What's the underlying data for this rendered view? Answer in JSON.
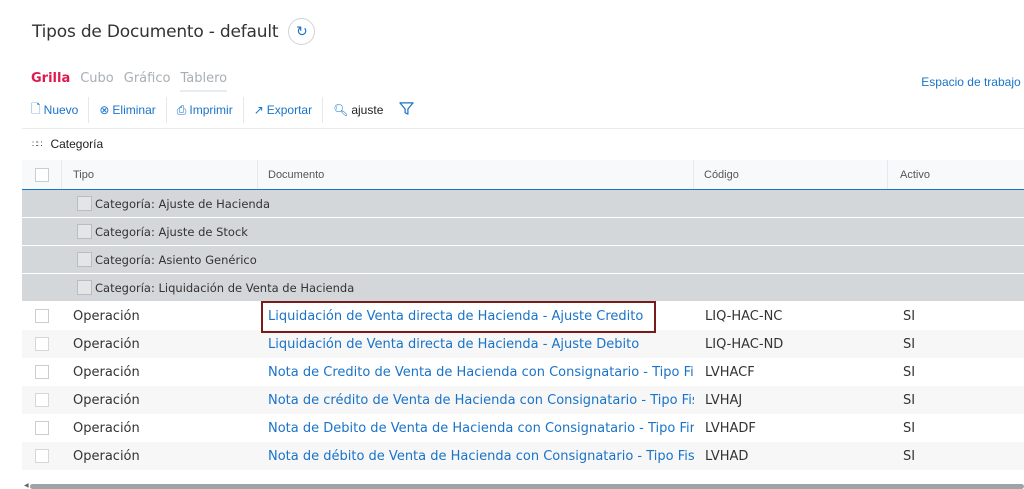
{
  "header": {
    "title": "Tipos de Documento - default"
  },
  "tabs": [
    "Grilla",
    "Cubo",
    "Gráfico",
    "Tablero"
  ],
  "workspace": {
    "label": "Espacio de trabajo"
  },
  "toolbar": {
    "new_label": "Nuevo",
    "delete_label": "Eliminar",
    "print_label": "Imprimir",
    "export_label": "Exportar",
    "search_value": "ajuste"
  },
  "groupby": {
    "label": "Categoría"
  },
  "grid": {
    "columns": [
      "Tipo",
      "Documento",
      "Código",
      "Activo"
    ],
    "groups": [
      "Categoría: Ajuste de Hacienda",
      "Categoría: Ajuste de Stock",
      "Categoría: Asiento Genérico",
      "Categoría: Liquidación de Venta de Hacienda"
    ],
    "rows": [
      {
        "tipo": "Operación",
        "documento": "Liquidación de Venta directa de Hacienda - Ajuste Credito",
        "codigo": "LIQ-HAC-NC",
        "activo": "SI"
      },
      {
        "tipo": "Operación",
        "documento": "Liquidación de Venta directa de Hacienda - Ajuste Debito",
        "codigo": "LIQ-HAC-ND",
        "activo": "SI"
      },
      {
        "tipo": "Operación",
        "documento": "Nota de Credito de Venta de Hacienda con Consignatario - Tipo Fi",
        "codigo": "LVHACF",
        "activo": "SI"
      },
      {
        "tipo": "Operación",
        "documento": "Nota de crédito de Venta de Hacienda con Consignatario - Tipo Fis",
        "codigo": "LVHAJ",
        "activo": "SI"
      },
      {
        "tipo": "Operación",
        "documento": "Nota de Debito de Venta de Hacienda con Consignatario - Tipo Fir",
        "codigo": "LVHADF",
        "activo": "SI"
      },
      {
        "tipo": "Operación",
        "documento": "Nota de débito de Venta de Hacienda con Consignatario - Tipo Fis",
        "codigo": "LVHAD",
        "activo": "SI"
      }
    ]
  },
  "colors": {
    "accent": "#1a73c9",
    "active_tab": "#e0194f",
    "highlight": "#7a1b1b",
    "group_bg": "#d4d7da"
  }
}
